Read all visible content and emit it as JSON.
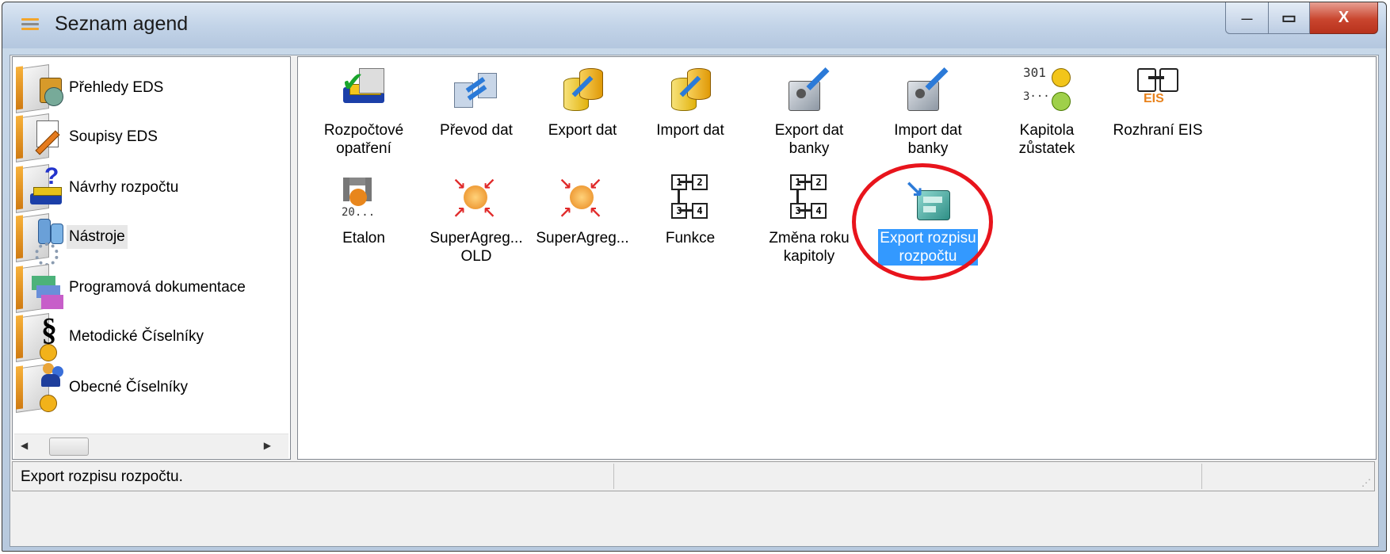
{
  "window": {
    "title": "Seznam agend",
    "controls": {
      "minimize": "—",
      "maximize": "▭",
      "close": "X"
    }
  },
  "sidebar": {
    "items": [
      {
        "label": "Přehledy EDS",
        "icon": "overview-books-icon"
      },
      {
        "label": "Soupisy EDS",
        "icon": "list-pen-icon"
      },
      {
        "label": "Návrhy rozpočtu",
        "icon": "budget-question-icon"
      },
      {
        "label": "Nástroje",
        "icon": "tools-gear-icon",
        "selected": true
      },
      {
        "label": "Programová dokumentace",
        "icon": "documentation-icon"
      },
      {
        "label": "Metodické Číselníky",
        "icon": "paragraph-icon"
      },
      {
        "label": "Obecné Číselníky",
        "icon": "people-icon"
      }
    ]
  },
  "tiles": [
    {
      "label": "Rozpočtové opatření",
      "lines": [
        "Rozpočtové",
        "opatření"
      ],
      "icon": "budget-check-icon"
    },
    {
      "label": "Převod dat",
      "lines": [
        "Převod dat"
      ],
      "icon": "data-transfer-icon"
    },
    {
      "label": "Export dat",
      "lines": [
        "Export dat"
      ],
      "icon": "export-data-icon"
    },
    {
      "label": "Import dat",
      "lines": [
        "Import dat"
      ],
      "icon": "import-data-icon"
    },
    {
      "label": "Export dat banky",
      "lines": [
        "Export dat",
        "banky"
      ],
      "icon": "bank-export-icon"
    },
    {
      "label": "Import dat banky",
      "lines": [
        "Import dat",
        "banky"
      ],
      "icon": "bank-import-icon"
    },
    {
      "label": "Kapitola zůstatek",
      "lines": [
        "Kapitola",
        "zůstatek"
      ],
      "icon": "coins-icon",
      "icon_text": [
        "301",
        "3···"
      ]
    },
    {
      "label": "Rozhraní EIS",
      "lines": [
        "Rozhraní EIS"
      ],
      "icon": "eis-interface-icon",
      "icon_text": [
        "EIS"
      ]
    },
    {
      "label": "Etalon",
      "lines": [
        "Etalon"
      ],
      "icon": "caliper-icon",
      "icon_text": [
        "20..."
      ]
    },
    {
      "label": "SuperAgreg... OLD",
      "lines": [
        "SuperAgreg...",
        "OLD"
      ],
      "icon": "aggregate-arrows-icon"
    },
    {
      "label": "SuperAgreg...",
      "lines": [
        "SuperAgreg..."
      ],
      "icon": "aggregate-arrows-icon"
    },
    {
      "label": "Funkce",
      "lines": [
        "Funkce"
      ],
      "icon": "function-tree-icon",
      "icon_text": [
        "1",
        "2",
        "3",
        "4"
      ]
    },
    {
      "label": "Změna roku kapitoly",
      "lines": [
        "Změna roku",
        "kapitoly"
      ],
      "icon": "year-change-tree-icon",
      "icon_text": [
        "1",
        "2",
        "3",
        "4"
      ]
    },
    {
      "label": "Export rozpisu rozpočtu",
      "lines": [
        "Export rozpisu",
        "rozpočtu"
      ],
      "icon": "export-budget-stairs-icon",
      "selected": true
    }
  ],
  "status_bar": {
    "text": "Export rozpisu rozpočtu."
  },
  "colors": {
    "selection": "#3399ff",
    "highlight_circle": "#e8141c",
    "title_bar": "#c3d4e8"
  }
}
